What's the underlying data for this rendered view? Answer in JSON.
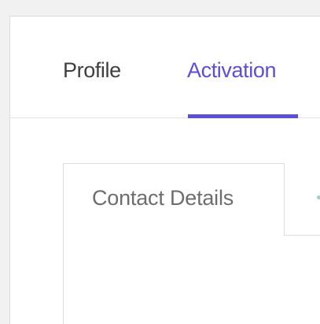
{
  "tabs": {
    "profile": "Profile",
    "activation": "Activation",
    "active": "Activation"
  },
  "sub_tabs": {
    "contact_details": "Contact Details"
  },
  "colors": {
    "accent": "#5b4fd8",
    "tab_text": "#3f3f3f",
    "sub_tab_text": "#6d6d6d",
    "border": "#dcdcdc",
    "background": "#ffffff"
  }
}
